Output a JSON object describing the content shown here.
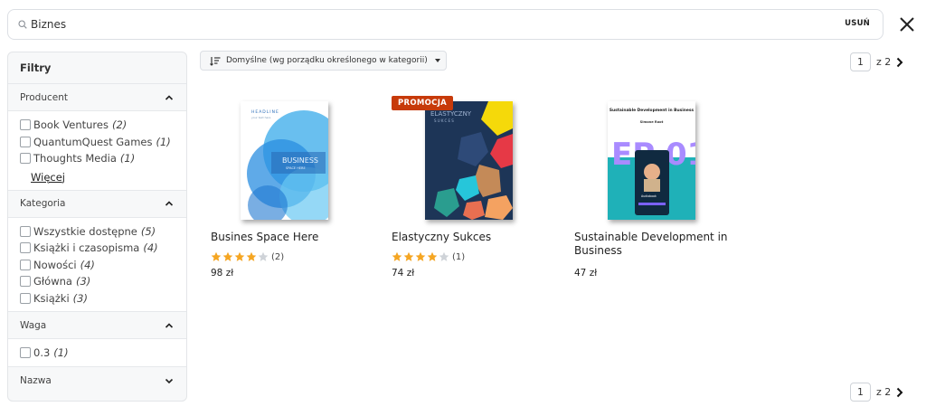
{
  "search": {
    "value": "Biznes",
    "clear_label": "USUŃ"
  },
  "sidebar": {
    "title": "Filtry",
    "producer": {
      "label": "Producent",
      "options": [
        {
          "label": "Book Ventures",
          "count": "(2)"
        },
        {
          "label": "QuantumQuest Games",
          "count": "(1)"
        },
        {
          "label": "Thoughts Media",
          "count": "(1)"
        }
      ],
      "more_label": "Więcej"
    },
    "category": {
      "label": "Kategoria",
      "options": [
        {
          "label": "Wszystkie dostępne",
          "count": "(5)"
        },
        {
          "label": "Książki i czasopisma",
          "count": "(4)"
        },
        {
          "label": "Nowości",
          "count": "(4)"
        },
        {
          "label": "Główna",
          "count": "(3)"
        },
        {
          "label": "Książki",
          "count": "(3)"
        }
      ]
    },
    "weight": {
      "label": "Waga",
      "options": [
        {
          "label": "0.3",
          "count": "(1)"
        }
      ]
    },
    "name": {
      "label": "Nazwa"
    }
  },
  "sort": {
    "label": "Domyślne (wg porządku określonego w kategorii)"
  },
  "pagination": {
    "current": "1",
    "of_label": "z 2"
  },
  "products": [
    {
      "title": "Busines Space Here",
      "rating": 4,
      "reviews": "(2)",
      "price": "98 zł",
      "cover": {
        "headline": "HEADLINE",
        "sub": "your text here",
        "big": "BUSINESS",
        "big2": "SPACE HERE"
      }
    },
    {
      "title": "Elastyczny Sukces",
      "rating": 4,
      "reviews": "(1)",
      "price": "74 zł",
      "badge": "PROMOCJA",
      "cover": {
        "big": "ELASTYCZNY",
        "big2": "SUKCES"
      }
    },
    {
      "title": "Sustainable Development in Business",
      "price": "47 zł",
      "cover": {
        "headline": "Sustainable Development in Business",
        "author": "Simone Root",
        "big": "EP 01",
        "sub": "Audiobook"
      }
    }
  ],
  "colors": {
    "accent": "#c73a0a",
    "star": "#f5a623",
    "star_empty": "#cfd3d8"
  }
}
